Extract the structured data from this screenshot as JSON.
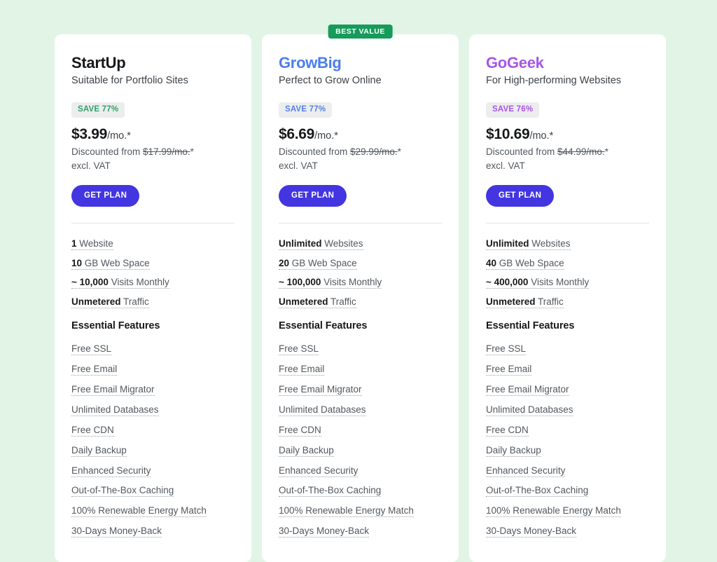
{
  "page": {
    "background_color": "#e2f4e6",
    "card_background": "#ffffff"
  },
  "badges": {
    "best_value": "BEST VALUE",
    "best_value_color": "#159b5a"
  },
  "common": {
    "price_suffix": "/mo.*",
    "discount_prefix": "Discounted from ",
    "discount_suffix": "*",
    "vat_note": "excl. VAT",
    "cta_label": "GET PLAN",
    "cta_color": "#4336e0",
    "features_heading": "Essential Features",
    "features": [
      "Free SSL",
      "Free Email",
      "Free Email Migrator",
      "Unlimited Databases",
      "Free CDN",
      "Daily Backup",
      "Enhanced Security",
      "Out-of-The-Box Caching",
      "100% Renewable Energy Match",
      "30-Days Money-Back"
    ]
  },
  "plans": [
    {
      "id": "startup",
      "name": "StartUp",
      "name_color": "#17181a",
      "subtitle": "Suitable for Portfolio Sites",
      "save_label": "SAVE 77%",
      "save_color": "#31a06a",
      "price": "$3.99",
      "old_price": "$17.99/mo.",
      "specs": [
        {
          "value": "1",
          "label": " Website"
        },
        {
          "value": "10",
          "label": " GB Web Space"
        },
        {
          "value": "~ 10,000",
          "label": " Visits Monthly"
        },
        {
          "value": "Unmetered",
          "label": " Traffic"
        }
      ]
    },
    {
      "id": "growbig",
      "name": "GrowBig",
      "name_color": "#4a7ef0",
      "subtitle": "Perfect to Grow Online",
      "save_label": "SAVE 77%",
      "save_color": "#5580ef",
      "price": "$6.69",
      "old_price": "$29.99/mo.",
      "best_value": true,
      "specs": [
        {
          "value": "Unlimited",
          "label": " Websites"
        },
        {
          "value": "20",
          "label": " GB Web Space"
        },
        {
          "value": "~ 100,000",
          "label": " Visits Monthly"
        },
        {
          "value": "Unmetered",
          "label": " Traffic"
        }
      ]
    },
    {
      "id": "gogeek",
      "name": "GoGeek",
      "name_color": "#a855e8",
      "subtitle": "For High-performing Websites",
      "save_label": "SAVE 76%",
      "save_color": "#a855e8",
      "price": "$10.69",
      "old_price": "$44.99/mo.",
      "specs": [
        {
          "value": "Unlimited",
          "label": " Websites"
        },
        {
          "value": "40",
          "label": " GB Web Space"
        },
        {
          "value": "~ 400,000",
          "label": " Visits Monthly"
        },
        {
          "value": "Unmetered",
          "label": " Traffic"
        }
      ]
    }
  ]
}
